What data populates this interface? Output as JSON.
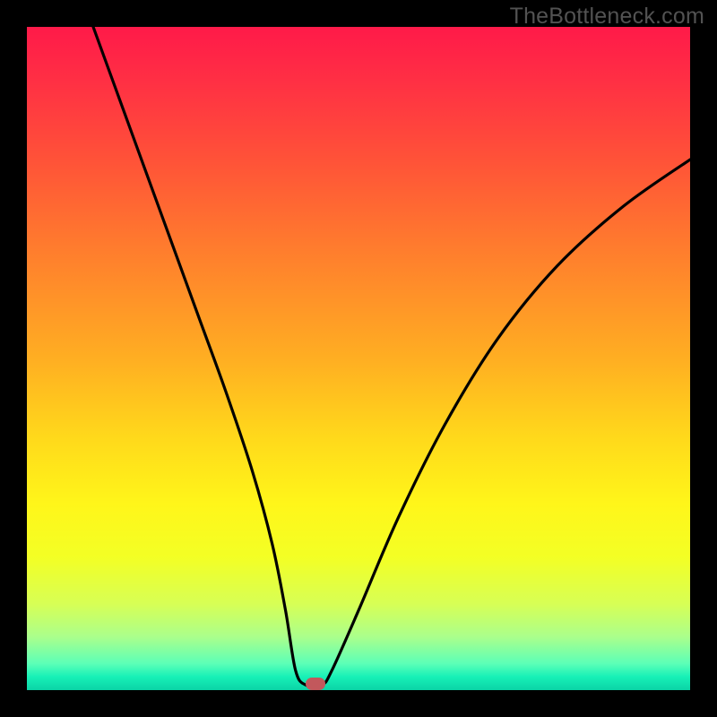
{
  "watermark": "TheBottleneck.com",
  "chart_data": {
    "type": "line",
    "title": "",
    "xlabel": "",
    "ylabel": "",
    "xlim": [
      0,
      100
    ],
    "ylim": [
      0,
      100
    ],
    "grid": false,
    "legend": false,
    "series": [
      {
        "name": "curve",
        "x": [
          10,
          14,
          18,
          22,
          26,
          30,
          34,
          37,
          39,
          40.5,
          42,
          44.5,
          46,
          50,
          56,
          63,
          71,
          80,
          90,
          100
        ],
        "y": [
          100,
          89,
          78,
          67,
          56,
          45,
          33,
          22,
          12,
          3,
          0.8,
          0.8,
          3,
          12,
          26,
          40,
          53,
          64,
          73,
          80
        ]
      }
    ],
    "marker": {
      "x": 43.5,
      "y": 0.9
    },
    "gradient_stops": [
      {
        "pos": 0,
        "color": "#ff1a49"
      },
      {
        "pos": 50,
        "color": "#ffae22"
      },
      {
        "pos": 72,
        "color": "#fff61a"
      },
      {
        "pos": 100,
        "color": "#0bd3a6"
      }
    ]
  }
}
